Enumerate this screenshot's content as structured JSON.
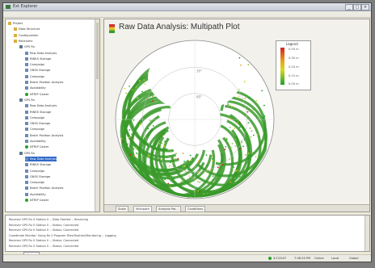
{
  "window": {
    "title": "Ext Explorer",
    "buttons": [
      "_",
      "□",
      "×"
    ]
  },
  "menubar": {
    "items": [
      "File",
      "Data Manipulation",
      "View",
      "Help"
    ]
  },
  "tree": {
    "items": [
      {
        "label": "Project",
        "depth": 0,
        "icon": "folder-icon"
      },
      {
        "label": "Data Structure",
        "depth": 1,
        "icon": "folder-icon"
      },
      {
        "label": "Configuration",
        "depth": 1,
        "icon": "folder-icon"
      },
      {
        "label": "Receivers",
        "depth": 1,
        "icon": "folder-icon"
      },
      {
        "label": "GPS Rx",
        "depth": 2,
        "icon": "receiver-icon"
      },
      {
        "label": "Raw Data Analysis",
        "depth": 3,
        "icon": "doc-icon"
      },
      {
        "label": "RINEX Storage",
        "depth": 3,
        "icon": "doc-icon"
      },
      {
        "label": "Campaign",
        "depth": 3,
        "icon": "doc-icon"
      },
      {
        "label": "GNSS Storage",
        "depth": 3,
        "icon": "doc-icon"
      },
      {
        "label": "Campaign",
        "depth": 3,
        "icon": "doc-icon"
      },
      {
        "label": "Batch Position Analysis",
        "depth": 3,
        "icon": "doc-icon"
      },
      {
        "label": "Availability",
        "depth": 3,
        "icon": "doc-icon"
      },
      {
        "label": "NTRIP Caster",
        "depth": 3,
        "icon": "green-dot-icon"
      },
      {
        "label": "GPS Rx",
        "depth": 2,
        "icon": "receiver-icon"
      },
      {
        "label": "Raw Data Analysis",
        "depth": 3,
        "icon": "doc-icon"
      },
      {
        "label": "RINEX Storage",
        "depth": 3,
        "icon": "doc-icon"
      },
      {
        "label": "Campaign",
        "depth": 3,
        "icon": "doc-icon"
      },
      {
        "label": "GNSS Storage",
        "depth": 3,
        "icon": "doc-icon"
      },
      {
        "label": "Campaign",
        "depth": 3,
        "icon": "doc-icon"
      },
      {
        "label": "Batch Position Analysis",
        "depth": 3,
        "icon": "doc-icon"
      },
      {
        "label": "Availability",
        "depth": 3,
        "icon": "doc-icon"
      },
      {
        "label": "NTRIP Caster",
        "depth": 3,
        "icon": "green-dot-icon"
      },
      {
        "label": "GPS Rx",
        "depth": 2,
        "icon": "receiver-icon"
      },
      {
        "label": "Raw Data Analysis",
        "depth": 3,
        "icon": "doc-icon",
        "selected": true
      },
      {
        "label": "RINEX Storage",
        "depth": 3,
        "icon": "doc-icon"
      },
      {
        "label": "Campaign",
        "depth": 3,
        "icon": "doc-icon"
      },
      {
        "label": "GNSS Storage",
        "depth": 3,
        "icon": "doc-icon"
      },
      {
        "label": "Campaign",
        "depth": 3,
        "icon": "doc-icon"
      },
      {
        "label": "Batch Position Analysis",
        "depth": 3,
        "icon": "doc-icon"
      },
      {
        "label": "Availability",
        "depth": 3,
        "icon": "doc-icon"
      },
      {
        "label": "NTRIP Caster",
        "depth": 3,
        "icon": "green-dot-icon"
      }
    ]
  },
  "main": {
    "title": "Raw Data Analysis: Multipath Plot",
    "tabs": [
      "Scale",
      "Multipath",
      "Analysis Par...",
      "Conditions"
    ],
    "active_tab": 1
  },
  "chart_data": {
    "type": "scatter",
    "title": "Raw Data Analysis: Multipath Plot",
    "projection": "polar sky plot",
    "elevation_rings": [
      "30°",
      "60°"
    ],
    "legend": {
      "title": "Legend",
      "entries": [
        "0.50 m",
        "0.30 m",
        "0.20 m",
        "0.10 m",
        "0.00 m"
      ],
      "colors": [
        "#d02020",
        "#e8a020",
        "#d8d820",
        "#8cc830",
        "#20a030"
      ]
    },
    "dominant_color": "#3a9a2a"
  },
  "console": {
    "lines": [
      "Receiver GPS Rx 0 Station 0 -- Data Started -- Receiving",
      "Receiver GPS Rx 0 Station 0 -- Status: Connected",
      "Receiver GPS Rx 0 Station 0 -- Status: Connected",
      "Coordinate Monitor: Using Rx 0 Program Files\\Position\\Monitoring -- Logging",
      "Receiver GPS Rx 0 Station 0 -- Status: Connected",
      "Receiver GPS Rx 0 Station 0 -- Status: Connected"
    ],
    "tab_label": "Output"
  },
  "statusbar": {
    "items": [
      "3/7/2007",
      "7:58:35 PM",
      "Online",
      "Local",
      "Global"
    ],
    "led_color": "#2aa02a"
  }
}
